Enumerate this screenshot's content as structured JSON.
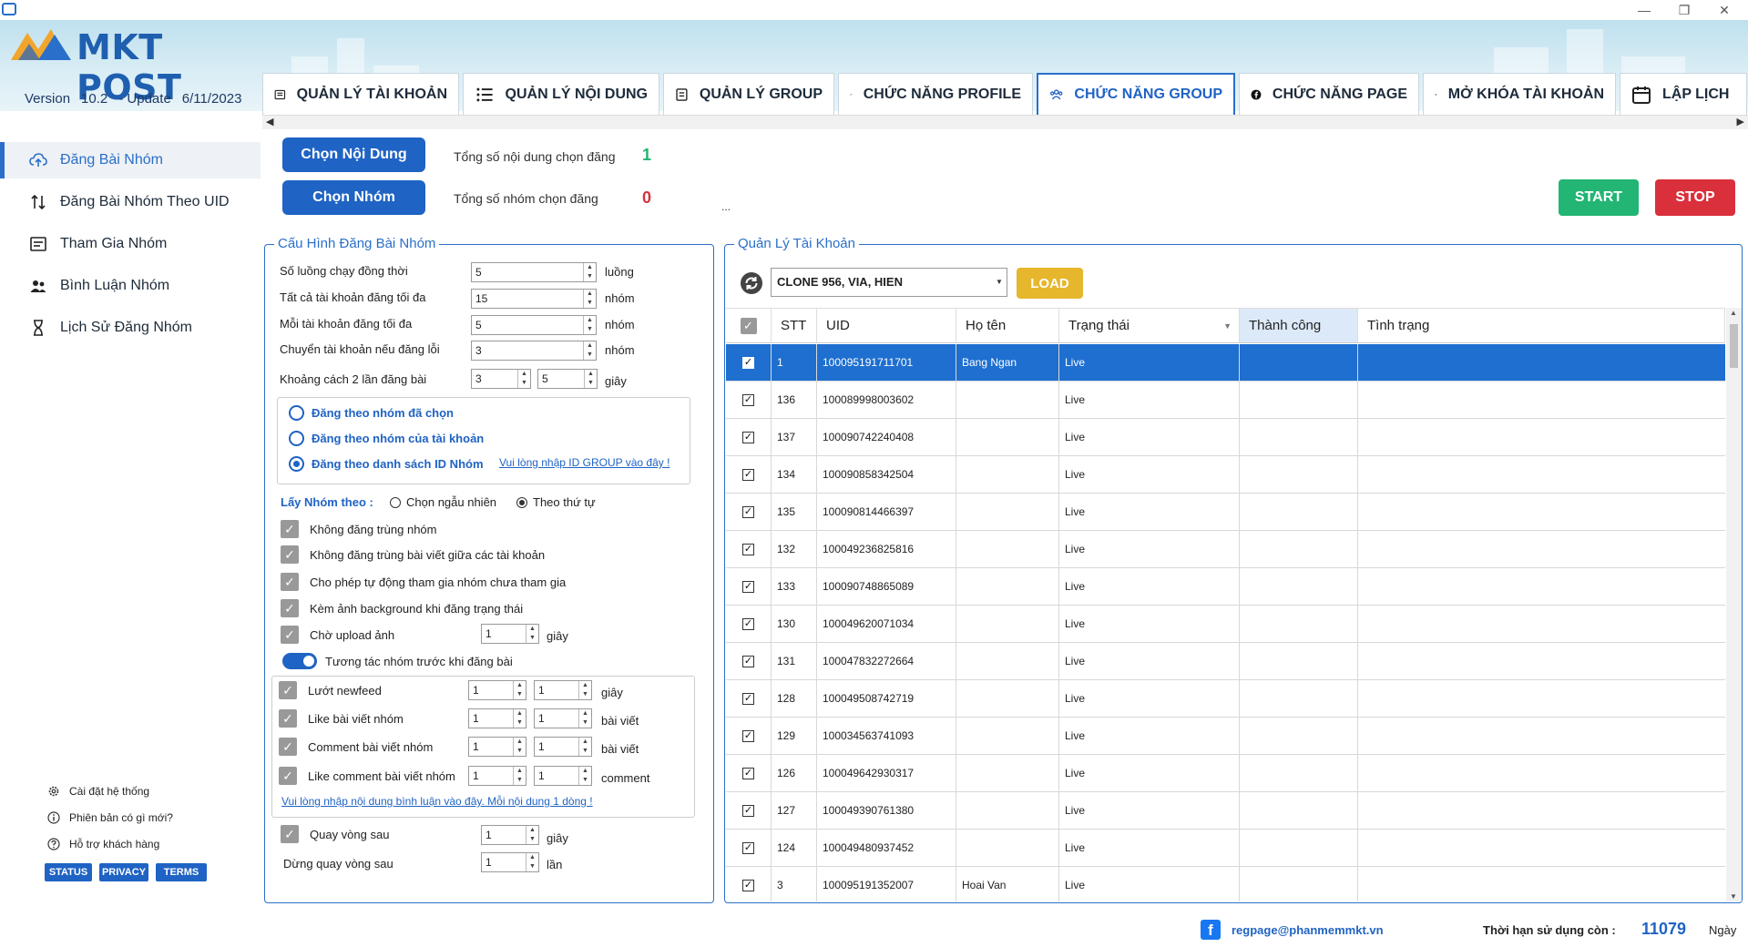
{
  "window": {
    "minimize": "—",
    "restore": "❐",
    "close": "✕"
  },
  "brand": {
    "name": "MKT POST",
    "version_label": "Version",
    "version": "10.2",
    "update_label": "- Update",
    "update_date": "6/11/2023"
  },
  "tabs": [
    {
      "label": "QUẢN LÝ TÀI KHOẢN",
      "icon": "account-list-icon"
    },
    {
      "label": "QUẢN LÝ NỘI DUNG",
      "icon": "content-list-icon"
    },
    {
      "label": "QUẢN LÝ GROUP",
      "icon": "group-list-icon"
    },
    {
      "label": "CHỨC NĂNG PROFILE",
      "icon": "profile-icon"
    },
    {
      "label": "CHỨC NĂNG GROUP",
      "icon": "group-icon",
      "active": true
    },
    {
      "label": "CHỨC NĂNG PAGE",
      "icon": "facebook-icon"
    },
    {
      "label": "MỞ KHÓA TÀI KHOẢN",
      "icon": "fingerprint-icon"
    },
    {
      "label": "LẬP LỊCH",
      "icon": "calendar-icon"
    }
  ],
  "sidebar": {
    "items": [
      {
        "label": "Đăng Bài Nhóm",
        "active": true
      },
      {
        "label": "Đăng Bài Nhóm Theo UID"
      },
      {
        "label": "Tham Gia Nhóm"
      },
      {
        "label": "Bình Luận Nhóm"
      },
      {
        "label": "Lịch Sử Đăng Nhóm"
      }
    ],
    "footer_links": [
      "Cài đặt hệ thống",
      "Phiên bản có gì mới?",
      "Hỗ trợ khách hàng"
    ],
    "pills": [
      "STATUS",
      "PRIVACY",
      "TERMS"
    ]
  },
  "top": {
    "choose_content": "Chọn Nội Dung",
    "choose_group": "Chọn Nhóm",
    "content_count_label": "Tổng số nội dung chọn đăng",
    "content_count": "1",
    "group_count_label": "Tổng số nhóm chọn đăng",
    "group_count": "0",
    "ellipsis": "...",
    "start": "START",
    "stop": "STOP"
  },
  "config": {
    "title": "Cấu Hình Đăng Bài Nhóm",
    "rows": [
      {
        "label": "Số luồng chạy đồng thời",
        "value": "5",
        "unit": "luồng"
      },
      {
        "label": "Tất cả tài khoản đăng tối đa",
        "value": "15",
        "unit": "nhóm"
      },
      {
        "label": "Mỗi tài khoản đăng tối đa",
        "value": "5",
        "unit": "nhóm"
      },
      {
        "label": "Chuyển tài khoản nếu đăng lỗi",
        "value": "3",
        "unit": "nhóm"
      }
    ],
    "interval": {
      "label": "Khoảng cách 2 lần đăng bài",
      "from": "3",
      "to": "5",
      "unit": "giây"
    },
    "post_modes": [
      {
        "label": "Đăng theo nhóm đã chọn",
        "selected": false
      },
      {
        "label": "Đăng theo nhóm của tài khoản",
        "selected": false
      },
      {
        "label": "Đăng theo danh sách ID Nhóm",
        "selected": true
      }
    ],
    "id_group_link": "Vui lòng nhập ID GROUP vào đây !",
    "get_group_label": "Lấy Nhóm theo :",
    "get_group_random": "Chọn ngẫu nhiên",
    "get_group_order": "Theo thứ tự",
    "checks": [
      "Không đăng trùng nhóm",
      "Không đăng trùng bài viết giữa các tài khoản",
      "Cho phép tự động tham gia nhóm chưa tham gia",
      "Kèm ảnh background khi đăng trạng thái"
    ],
    "upload_wait": {
      "label": "Chờ upload ảnh",
      "value": "1",
      "unit": "giây"
    },
    "interact_toggle": "Tương tác nhóm trước khi đăng bài",
    "interact_rows": [
      {
        "label": "Lướt newfeed",
        "a": "1",
        "b": "1",
        "unit": "giây"
      },
      {
        "label": "Like bài viết nhóm",
        "a": "1",
        "b": "1",
        "unit": "bài viết"
      },
      {
        "label": "Comment bài viết nhóm",
        "a": "1",
        "b": "1",
        "unit": "bài viết"
      },
      {
        "label": "Like comment bài viết nhóm",
        "a": "1",
        "b": "1",
        "unit": "comment"
      }
    ],
    "comment_link": "Vui lòng nhập nội dung bình luận vào đây. Mỗi nội dung 1 dòng !",
    "loop": {
      "label": "Quay vòng sau",
      "value": "1",
      "unit": "giây"
    },
    "stop_loop": {
      "label": "Dừng quay vòng sau",
      "value": "1",
      "unit": "lần"
    }
  },
  "accounts": {
    "title": "Quản Lý Tài Khoản",
    "combo_value": "CLONE 956, VIA, HIEN",
    "load": "LOAD",
    "columns": [
      "STT",
      "UID",
      "Họ tên",
      "Trạng thái",
      "Thành công",
      "Tình trạng"
    ],
    "rows": [
      {
        "stt": "1",
        "uid": "100095191711701",
        "name": "Bang Ngan",
        "status": "Live",
        "selected": true
      },
      {
        "stt": "136",
        "uid": "100089998003602",
        "name": "",
        "status": "Live"
      },
      {
        "stt": "137",
        "uid": "100090742240408",
        "name": "",
        "status": "Live"
      },
      {
        "stt": "134",
        "uid": "100090858342504",
        "name": "",
        "status": "Live"
      },
      {
        "stt": "135",
        "uid": "100090814466397",
        "name": "",
        "status": "Live"
      },
      {
        "stt": "132",
        "uid": "100049236825816",
        "name": "",
        "status": "Live"
      },
      {
        "stt": "133",
        "uid": "100090748865089",
        "name": "",
        "status": "Live"
      },
      {
        "stt": "130",
        "uid": "100049620071034",
        "name": "",
        "status": "Live"
      },
      {
        "stt": "131",
        "uid": "100047832272664",
        "name": "",
        "status": "Live"
      },
      {
        "stt": "128",
        "uid": "100049508742719",
        "name": "",
        "status": "Live"
      },
      {
        "stt": "129",
        "uid": "100034563741093",
        "name": "",
        "status": "Live"
      },
      {
        "stt": "126",
        "uid": "100049642930317",
        "name": "",
        "status": "Live"
      },
      {
        "stt": "127",
        "uid": "100049390761380",
        "name": "",
        "status": "Live"
      },
      {
        "stt": "124",
        "uid": "100049480937452",
        "name": "",
        "status": "Live"
      },
      {
        "stt": "3",
        "uid": "100095191352007",
        "name": "Hoai Van",
        "status": "Live"
      }
    ]
  },
  "footer": {
    "email": "regpage@phanmemmkt.vn",
    "expiry_label": "Thời hạn sử dụng còn :",
    "expiry_days": "11079",
    "expiry_unit": "Ngày"
  },
  "colors": {
    "accent": "#1f63c4",
    "start": "#22b573",
    "stop": "#d9303c",
    "load": "#e6b62c",
    "selected_row": "#1e6fd0"
  }
}
